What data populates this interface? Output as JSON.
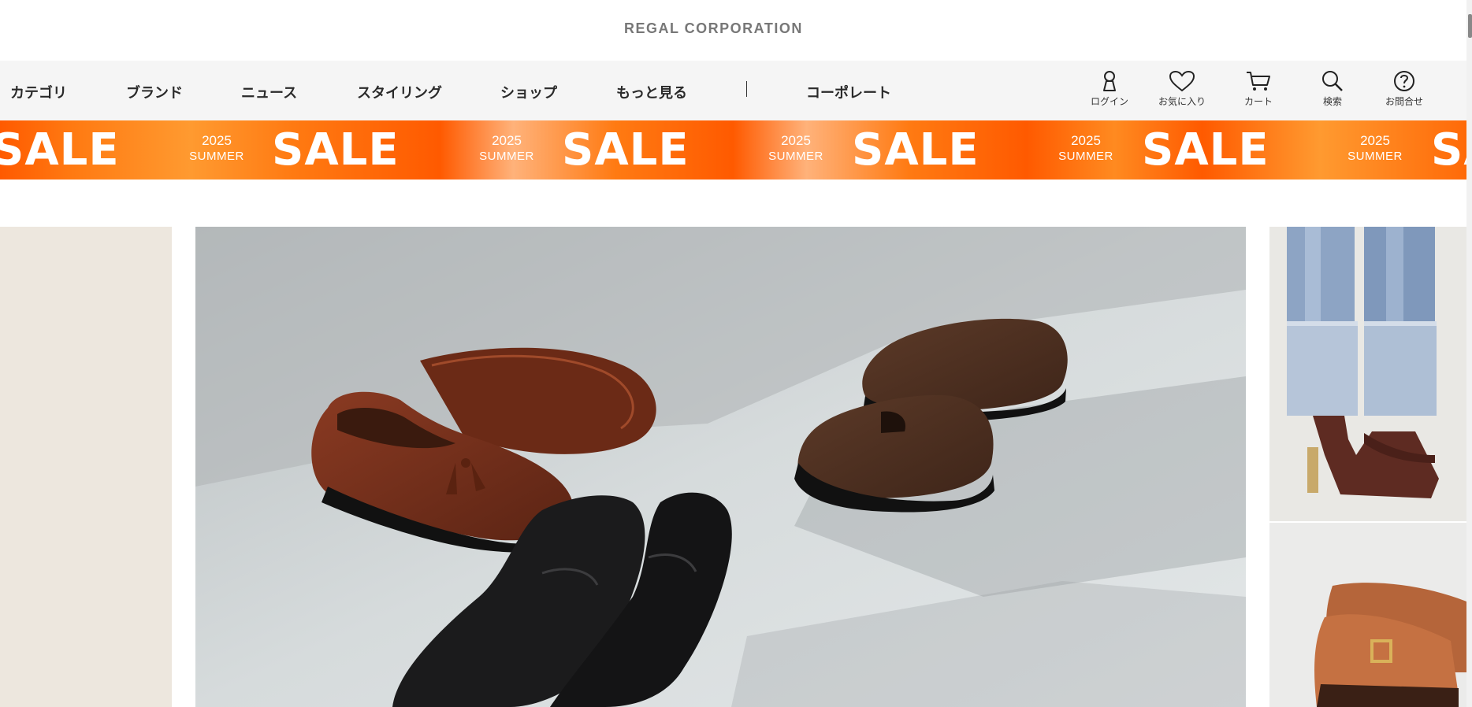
{
  "header": {
    "logo": "REGAL CORPORATION"
  },
  "nav": {
    "items": [
      {
        "label": "カテゴリ"
      },
      {
        "label": "ブランド"
      },
      {
        "label": "ニュース"
      },
      {
        "label": "スタイリング"
      },
      {
        "label": "ショップ"
      },
      {
        "label": "もっと見る"
      },
      {
        "label": "コーポレート"
      }
    ],
    "separator": "|",
    "icons": [
      {
        "icon": "user-icon",
        "label": "ログイン"
      },
      {
        "icon": "heart-icon",
        "label": "お気に入り"
      },
      {
        "icon": "cart-icon",
        "label": "カート"
      },
      {
        "icon": "search-icon",
        "label": "検索"
      },
      {
        "icon": "help-icon",
        "label": "お問合せ"
      }
    ]
  },
  "banner": {
    "year": "2025",
    "season": "SUMMER",
    "sale": "SALE",
    "colors": {
      "primary": "#ff5a00",
      "light": "#ffb27a",
      "text": "#ffffff"
    }
  },
  "carousel": {
    "slides": [
      {
        "name": "prev-slide"
      },
      {
        "name": "main-slide-loafers"
      },
      {
        "name": "next-slide-heels"
      },
      {
        "name": "next-slide-brown-shoes"
      }
    ]
  }
}
